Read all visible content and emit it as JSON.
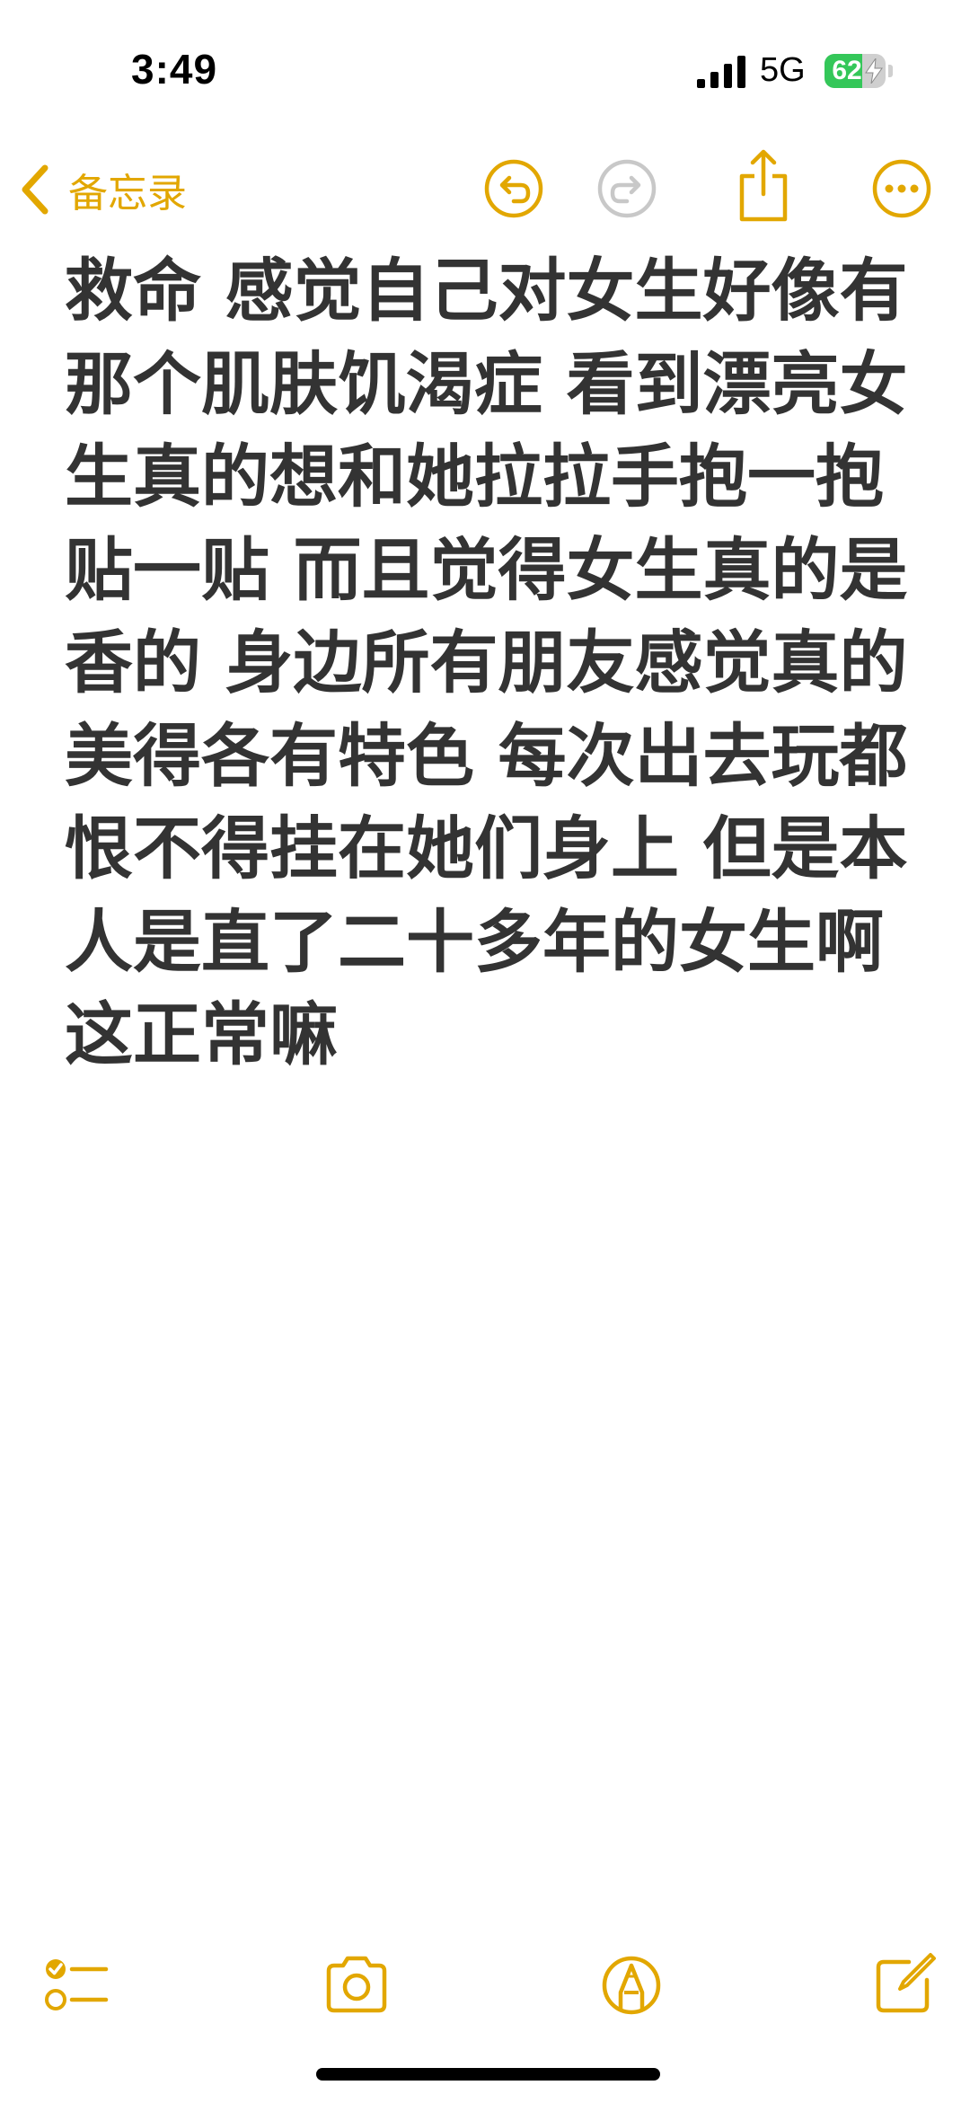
{
  "status_bar": {
    "time": "3:49",
    "network": "5G",
    "battery_level": "62",
    "battery_fraction": 0.62,
    "battery_charging": true
  },
  "nav": {
    "back_label": "备忘录",
    "icons": [
      "chevron-left-icon",
      "undo-icon",
      "redo-icon",
      "share-icon",
      "more-icon"
    ],
    "accent_color": "#e2a700",
    "disabled_color": "#c8c8c8"
  },
  "note": {
    "body": "救命 感觉自己对女生好像有那个肌肤饥渴症 看到漂亮女生真的想和她拉拉手抱一抱 贴一贴 而且觉得女生真的是香的 身边所有朋友感觉真的美得各有特色 每次出去玩都恨不得挂在她们身上 但是本人是直了二十多年的女生啊 这正常嘛"
  },
  "toolbar": {
    "icons": [
      "checklist-icon",
      "camera-icon",
      "markup-pen-icon",
      "compose-icon"
    ]
  }
}
